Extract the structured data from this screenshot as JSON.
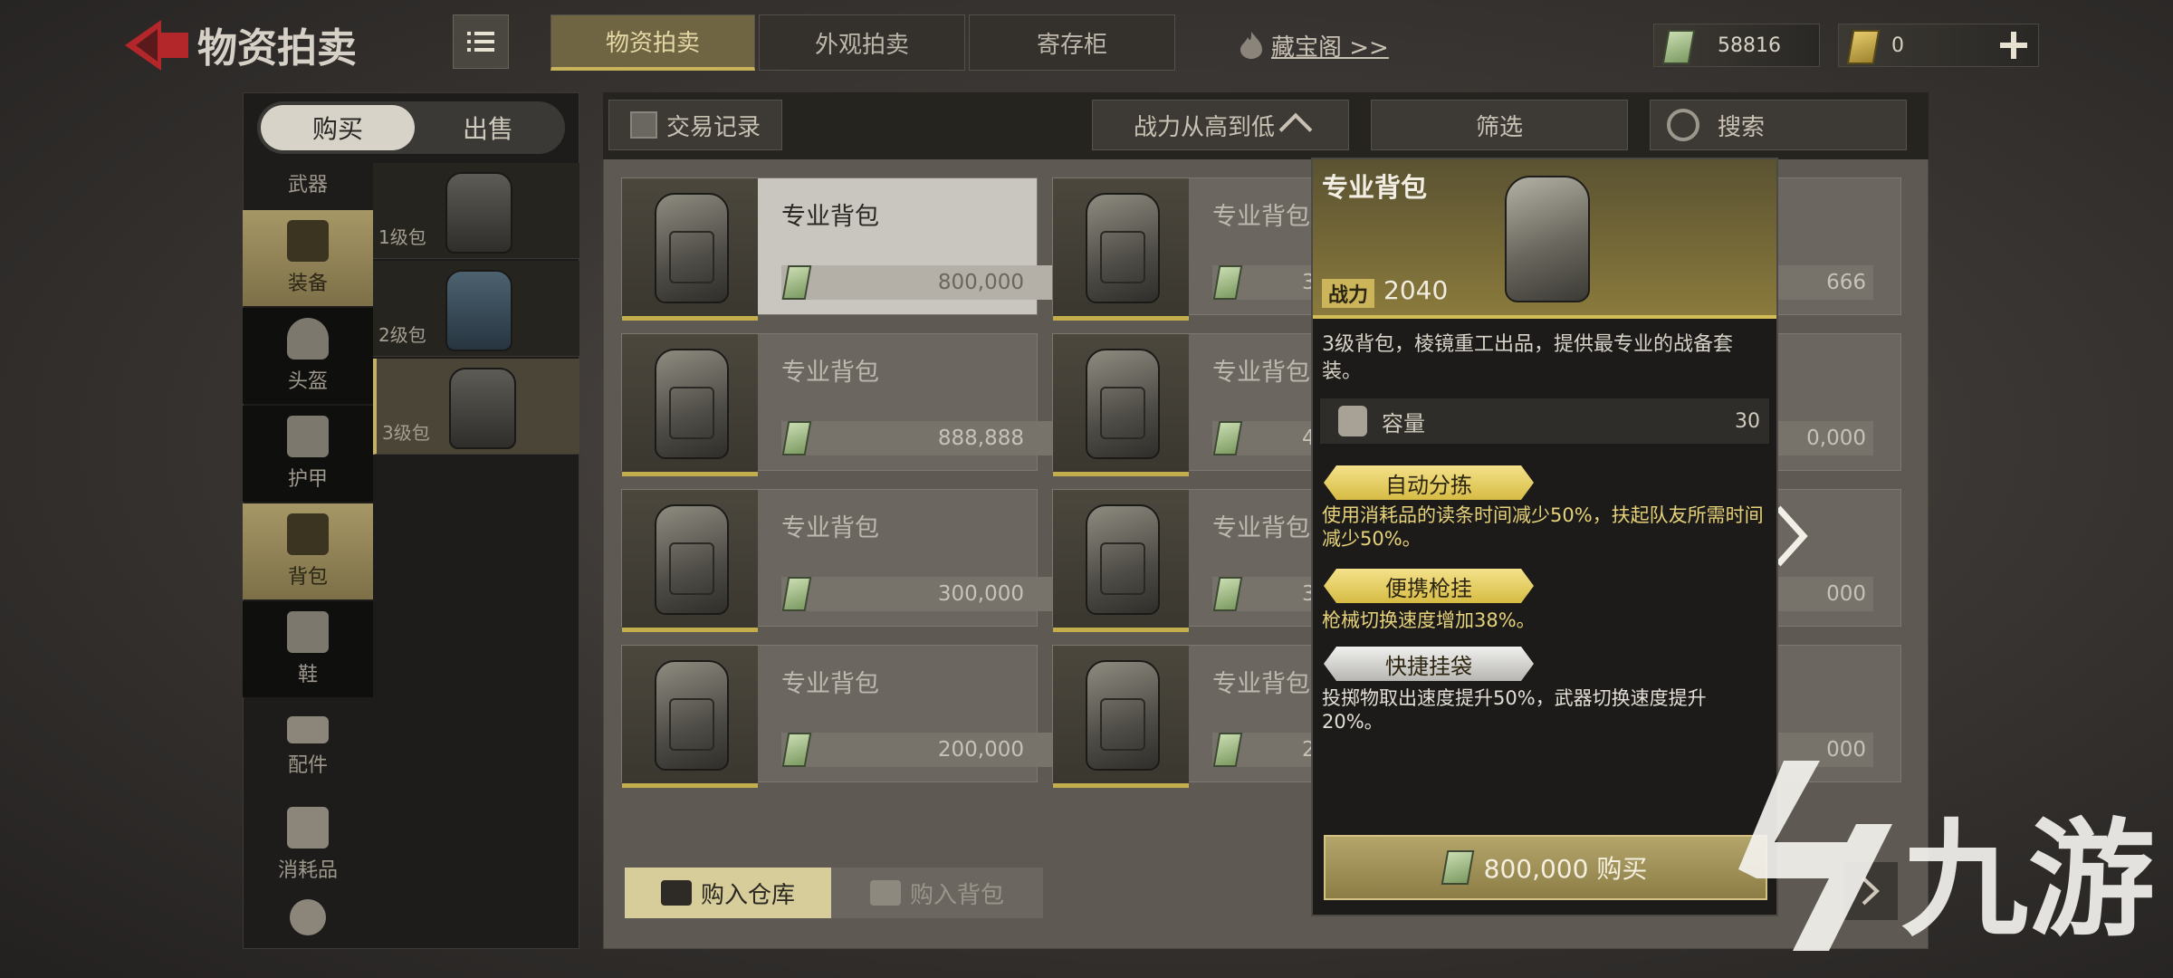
{
  "header": {
    "title": "物资拍卖",
    "tabs": [
      {
        "label": "物资拍卖",
        "active": true
      },
      {
        "label": "外观拍卖",
        "active": false
      },
      {
        "label": "寄存柜",
        "active": false
      }
    ],
    "treasure_link": "藏宝阁 >>",
    "currencies": [
      {
        "value": "58816"
      },
      {
        "value": "0"
      }
    ]
  },
  "sidebar": {
    "buy_label": "购买",
    "sell_label": "出售",
    "categories": [
      {
        "label": "武器"
      },
      {
        "label": "装备"
      },
      {
        "label": "头盔"
      },
      {
        "label": "护甲"
      },
      {
        "label": "背包"
      },
      {
        "label": "鞋"
      },
      {
        "label": "配件"
      },
      {
        "label": "消耗品"
      }
    ],
    "levels": [
      {
        "label": "1级包"
      },
      {
        "label": "2级包"
      },
      {
        "label": "3级包"
      }
    ]
  },
  "toolbar": {
    "trade_record": "交易记录",
    "sort": "战力从高到低",
    "filter": "筛选",
    "search": "搜索"
  },
  "listings": [
    {
      "name": "专业背包",
      "price": "800,000",
      "col2_partial": "3",
      "col3_partial": "666"
    },
    {
      "name": "专业背包",
      "price": "888,888",
      "col2_partial": "4",
      "col3_partial": "0,000"
    },
    {
      "name": "专业背包",
      "price": "300,000",
      "col2_partial": "3",
      "col3_partial": "000"
    },
    {
      "name": "专业背包",
      "price": "200,000",
      "col2_partial": "2",
      "col3_partial": "000"
    }
  ],
  "bottom": {
    "buy_to_warehouse": "购入仓库",
    "buy_to_backpack": "购入背包"
  },
  "detail": {
    "name": "专业背包",
    "power_label": "战力",
    "power_value": "2040",
    "description": "3级背包，棱镜重工出品，提供最专业的战备套装。",
    "capacity_label": "容量",
    "capacity_value": "30",
    "traits": [
      {
        "name": "自动分拣",
        "desc": "使用消耗品的读条时间减少50%，扶起队友所需时间减少50%。"
      },
      {
        "name": "便携枪挂",
        "desc": "枪械切换速度增加38%。"
      },
      {
        "name": "快捷挂袋",
        "desc": "投掷物取出速度提升50%，武器切换速度提升20%。"
      }
    ],
    "buy_button": "800,000 购买"
  },
  "watermark": {
    "text": "九游"
  },
  "colors": {
    "accent_gold": "#d2bd56",
    "trait_gold": "#e6d27a"
  }
}
